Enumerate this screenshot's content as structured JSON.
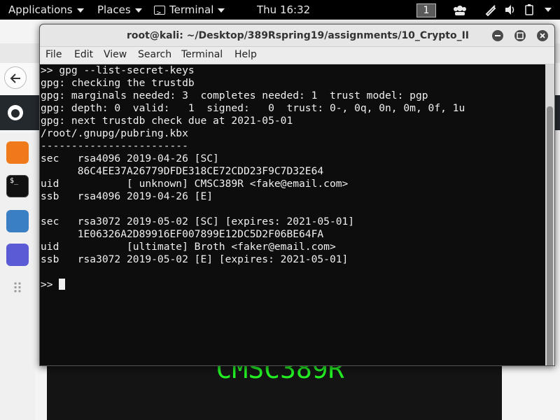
{
  "topbar": {
    "applications": "Applications",
    "places": "Places",
    "terminal": "Terminal",
    "clock": "Thu 16:32",
    "workspace": "1"
  },
  "terminal_window": {
    "title": "root@kali: ~/Desktop/389Rspring19/assignments/10_Crypto_II",
    "menu": [
      "File",
      "Edit",
      "View",
      "Search",
      "Terminal",
      "Help"
    ],
    "lines": [
      ">> gpg --list-secret-keys",
      "gpg: checking the trustdb",
      "gpg: marginals needed: 3  completes needed: 1  trust model: pgp",
      "gpg: depth: 0  valid:   1  signed:   0  trust: 0-, 0q, 0n, 0m, 0f, 1u",
      "gpg: next trustdb check due at 2021-05-01",
      "/root/.gnupg/pubring.kbx",
      "------------------------",
      "sec   rsa4096 2019-04-26 [SC]",
      "      86C4EE37A26779DFDE318CE72CDD23F9C7D32E64",
      "uid           [ unknown] CMSC389R <fake@email.com>",
      "ssb   rsa4096 2019-04-26 [E]",
      "",
      "sec   rsa3072 2019-05-02 [SC] [expires: 2021-05-01]",
      "      1E06326A2D89916EF007899E12DC5D2F06BE64FA",
      "uid           [ultimate] Broth <faker@email.com>",
      "ssb   rsa3072 2019-05-02 [E] [expires: 2021-05-01]",
      "",
      ">> "
    ]
  },
  "background": {
    "banner": "CMSC389R"
  },
  "colors": {
    "terminal_bg": "#0a0a0a",
    "terminal_fg": "#f0f0f0",
    "banner_green": "#22ee22",
    "topbar_bg": "#000000"
  }
}
